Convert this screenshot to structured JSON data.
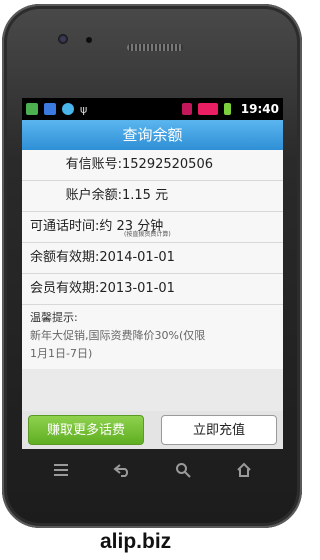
{
  "statusbar": {
    "time": "19:40",
    "icons_left": [
      "app-icon",
      "chat-icon",
      "message-icon",
      "usb-icon"
    ],
    "icons_right": [
      "mail-icon",
      "signal-icon",
      "battery-icon"
    ]
  },
  "header": {
    "title": "查询余额"
  },
  "info": {
    "account_label": "有信账号:",
    "account_value": "15292520506",
    "balance_label": "账户余额:",
    "balance_value": "1.15 元",
    "talk_label": "可通话时间:",
    "talk_value": "约 23 分钟",
    "talk_note": "(按直拨资费计算)",
    "balance_expire_label": "余额有效期:",
    "balance_expire_value": "2014-01-01",
    "member_expire_label": "会员有效期:",
    "member_expire_value": "2013-01-01"
  },
  "tip": {
    "title": "温馨提示:",
    "line1": "新年大促销,国际资费降价30%(仅限",
    "line2": "1月1日-7日)"
  },
  "buttons": {
    "earn": "赚取更多话费",
    "recharge": "立即充值"
  },
  "watermark": "alip.biz"
}
